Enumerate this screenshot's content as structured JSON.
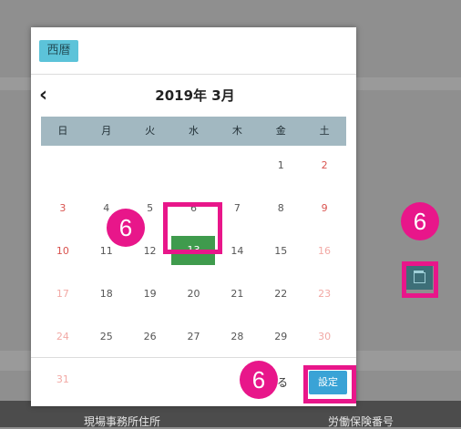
{
  "calendar": {
    "mode_label": "西暦",
    "month_title": "2019年 3月",
    "prev_icon": "chevron-left-icon",
    "weekdays": [
      "日",
      "月",
      "火",
      "水",
      "木",
      "金",
      "土"
    ],
    "weeks": [
      [
        "",
        "",
        "",
        "",
        "",
        "1",
        "2"
      ],
      [
        "3",
        "4",
        "5",
        "6",
        "7",
        "8",
        "9"
      ],
      [
        "10",
        "11",
        "12",
        "13",
        "14",
        "15",
        "16"
      ],
      [
        "17",
        "18",
        "19",
        "20",
        "21",
        "22",
        "23"
      ],
      [
        "24",
        "25",
        "26",
        "27",
        "28",
        "29",
        "30"
      ],
      [
        "31",
        "",
        "",
        "",
        "",
        "",
        ""
      ]
    ],
    "selected_day": "13",
    "close_label": "る",
    "set_label": "設定"
  },
  "annotations": {
    "badge_number": "6"
  },
  "background": {
    "footer_left": "現場事務所住所",
    "footer_right": "労働保険番号"
  },
  "colors": {
    "highlight": "#e8168a",
    "selected": "#3f9b4d",
    "set_button": "#3aa3d6",
    "mode_button": "#5cc3d9"
  }
}
